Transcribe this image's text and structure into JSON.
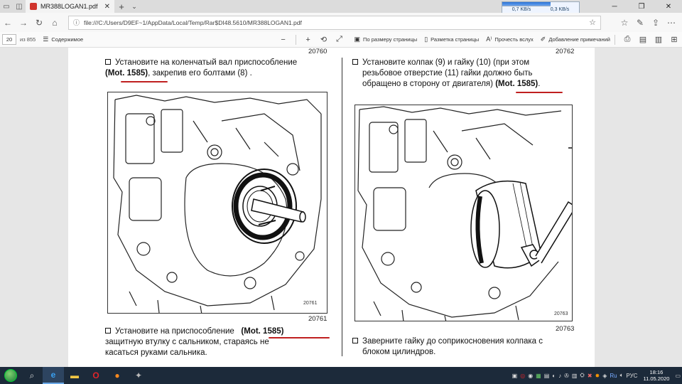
{
  "tabbar": {
    "tab_title": "MR388LOGAN1.pdf",
    "netmeter": {
      "down": "0,7 KB/s",
      "up": "0,3 KB/s"
    }
  },
  "address": {
    "url": "file:///C:/Users/D9EF~1/AppData/Local/Temp/Rar$DI48.5610/MR388LOGAN1.pdf"
  },
  "pdf_toolbar": {
    "page_number": "20",
    "page_count": "из 855",
    "contents_label": "Содержимое",
    "fit_page_label": "По размеру страницы",
    "layout_label": "Разметка страницы",
    "read_aloud_label": "Прочесть вслух",
    "add_notes_label": "Добавление примечаний"
  },
  "document": {
    "left": {
      "top_fig_no": "20760",
      "text1_prefix": "Установите на коленчатый вал приспособление",
      "text1_tool": "(Mot. 1585)",
      "text1_suffix": ", закрепив его болтами (8) .",
      "fig_inner_no": "20761",
      "fig_below_no": "20761",
      "text2_prefix": "Установите на приспособление",
      "text2_tool": "(Mot. 1585)",
      "text2_line2": "защитную втулку с сальником, стараясь не",
      "text2_line3": "касаться руками сальника."
    },
    "right": {
      "top_fig_no": "20762",
      "text1_line1": "Установите колпак (9) и гайку (10) (при этом",
      "text1_line2": "резьбовое отверстие (11) гайки должно быть",
      "text1_line3_prefix": "обращено в сторону от двигателя)",
      "text1_tool": "(Mot. 1585)",
      "text1_line3_suffix": ".",
      "fig_inner_no": "20763",
      "fig_below_no": "20763",
      "text2_line1": "Заверните гайку до соприкосновения колпака с",
      "text2_line2": "блоком цилиндров."
    }
  },
  "taskbar": {
    "language": "РУС",
    "time": "18:16",
    "date": "11.05.2020"
  },
  "colors": {
    "underline": "#c02020",
    "taskbar": "#1c2a3a"
  }
}
